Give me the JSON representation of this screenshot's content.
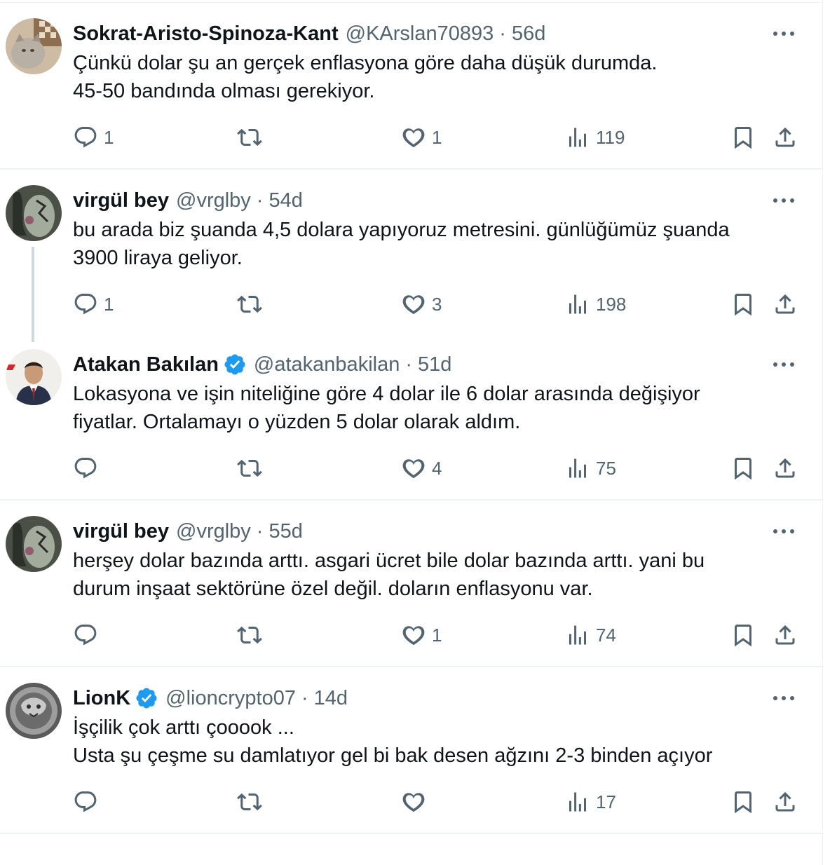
{
  "tweets": [
    {
      "name": "Sokrat-Aristo-Spinoza-Kant",
      "handle": "@KArslan70893",
      "time": "56d",
      "lines": [
        "Çünkü dolar şu an gerçek enflasyona göre daha düşük durumda.",
        "45-50 bandında olması gerekiyor."
      ],
      "replies": "1",
      "retweets": "",
      "likes": "1",
      "views": "119",
      "verified": false,
      "avatar_colors": [
        "#8a7560",
        "#c8b49a"
      ]
    },
    {
      "name": "virgül bey",
      "handle": "@vrglby",
      "time": "54d",
      "lines": [
        "bu arada biz şuanda 4,5 dolara yapıyoruz metresini. günlüğümüz şuanda",
        "3900 liraya geliyor."
      ],
      "replies": "1",
      "retweets": "",
      "likes": "3",
      "views": "198",
      "verified": false,
      "avatar_colors": [
        "#3b3f38",
        "#9aa394"
      ]
    },
    {
      "name": "Atakan Bakılan",
      "handle": "@atakanbakilan",
      "time": "51d",
      "lines": [
        "Lokasyona ve işin niteliğine göre 4 dolar ile 6 dolar arasında değişiyor",
        "fiyatlar. Ortalamayı o yüzden 5 dolar olarak aldım."
      ],
      "replies": "",
      "retweets": "",
      "likes": "4",
      "views": "75",
      "verified": true,
      "avatar_colors": [
        "#e9e6e2",
        "#2b3446"
      ]
    },
    {
      "name": "virgül bey",
      "handle": "@vrglby",
      "time": "55d",
      "lines": [
        "herşey dolar bazında arttı. asgari ücret bile dolar bazında arttı. yani bu",
        "durum inşaat sektörüne özel değil. doların enflasyonu var."
      ],
      "replies": "",
      "retweets": "",
      "likes": "1",
      "views": "74",
      "verified": false,
      "avatar_colors": [
        "#3b3f38",
        "#9aa394"
      ]
    },
    {
      "name": "LionK",
      "handle": "@lioncrypto07",
      "time": "14d",
      "lines": [
        "İşçilik çok arttı çooook ...",
        "Usta şu çeşme su damlatıyor gel bi bak desen ağzını 2-3 binden açıyor"
      ],
      "replies": "",
      "retweets": "",
      "likes": "",
      "views": "17",
      "verified": true,
      "avatar_colors": [
        "#4a4a4a",
        "#bdbdbd"
      ]
    }
  ],
  "colors": {
    "text": "#0f1419",
    "secondary": "#536471",
    "verified": "#1d9bf0",
    "divider": "#eff3f4",
    "thread_line": "#cfd9de"
  },
  "icons": [
    "reply-icon",
    "retweet-icon",
    "like-icon",
    "views-icon",
    "bookmark-icon",
    "share-icon",
    "more-icon",
    "verified-badge-icon"
  ]
}
